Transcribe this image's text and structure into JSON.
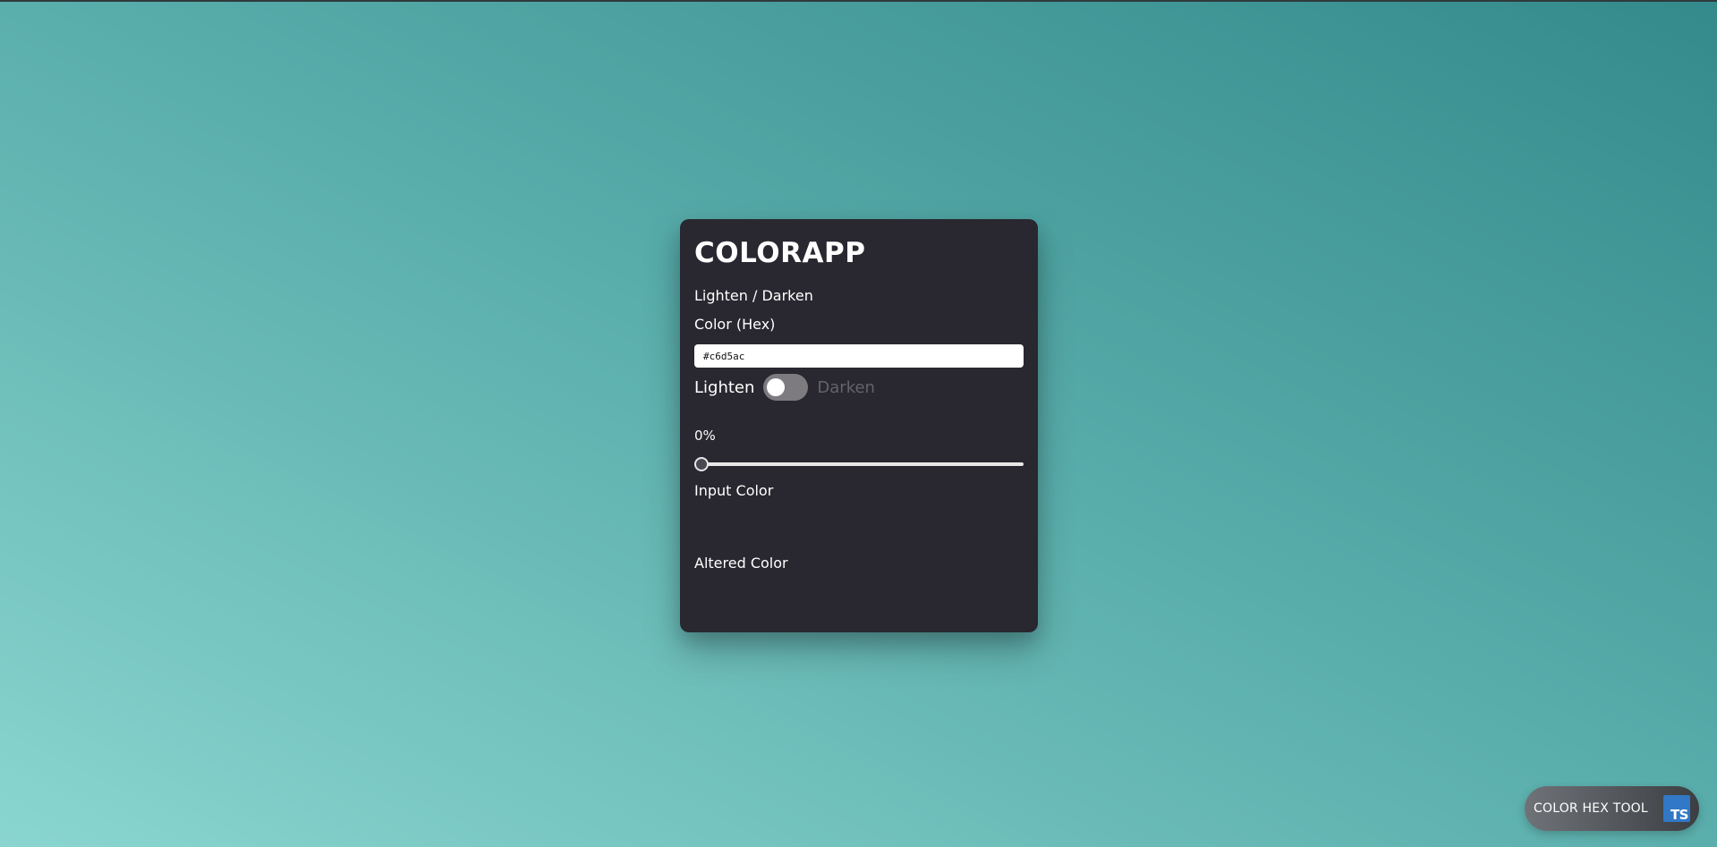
{
  "app": {
    "title": "COLORAPP",
    "subtitle": "Lighten / Darken"
  },
  "hex_field": {
    "label": "Color (Hex)",
    "value": "#c6d5ac"
  },
  "toggle": {
    "left_label": "Lighten",
    "right_label": "Darken",
    "selected": "Lighten"
  },
  "slider": {
    "display": "0%",
    "value_percent": 0
  },
  "input_color": {
    "label": "Input Color"
  },
  "altered_color": {
    "label": "Altered Color"
  },
  "badge": {
    "label": "COLOR HEX TOOL",
    "logo_text": "TS",
    "logo_color": "#3178c6"
  },
  "colors": {
    "card_background": "#29272f",
    "gradient_light": "#8ad5cf",
    "gradient_dark": "#348a8b"
  },
  "icons": {
    "badge_logo": "typescript-logo-icon",
    "toggle_knob": "toggle-knob-icon"
  }
}
